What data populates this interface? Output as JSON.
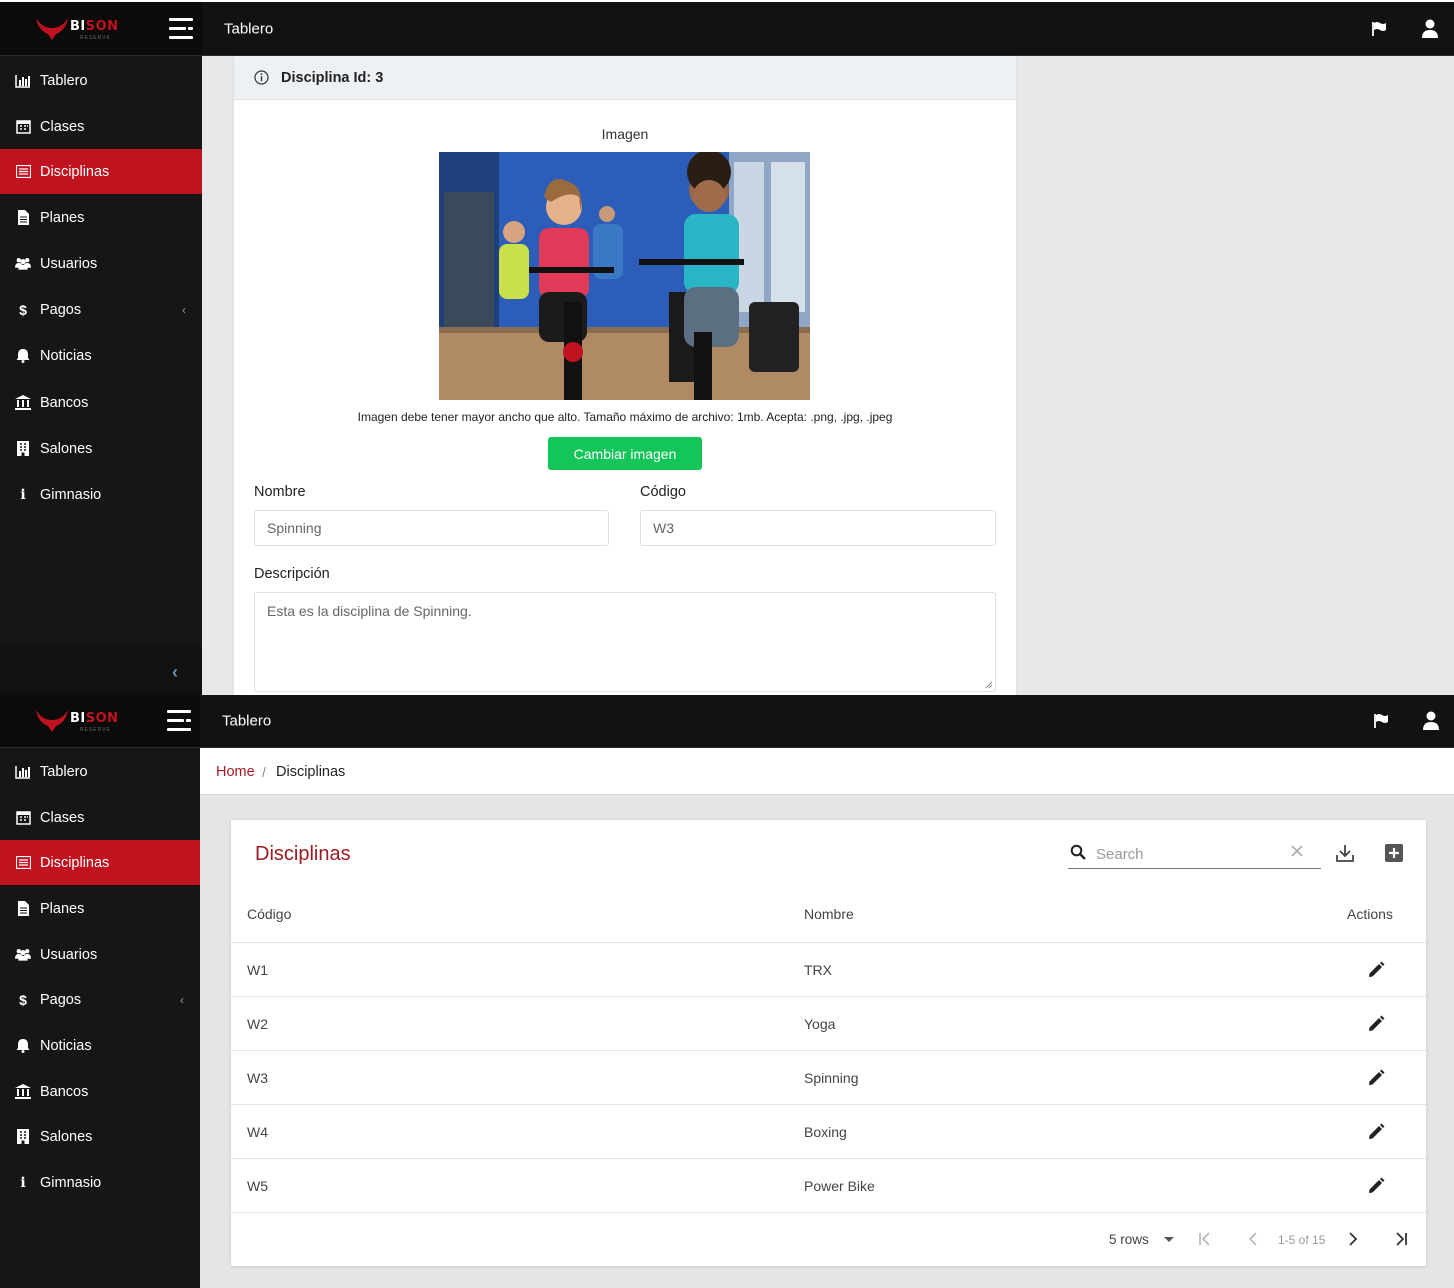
{
  "app": {
    "logo_text_white": "BI",
    "logo_text_red": "SON",
    "logo_subtext": "RESERVE",
    "header_title": "Tablero"
  },
  "sidebar": {
    "items": [
      {
        "label": "Tablero",
        "icon": "bar-chart-icon"
      },
      {
        "label": "Clases",
        "icon": "calendar-icon"
      },
      {
        "label": "Disciplinas",
        "icon": "list-icon",
        "active": true
      },
      {
        "label": "Planes",
        "icon": "document-icon"
      },
      {
        "label": "Usuarios",
        "icon": "users-icon"
      },
      {
        "label": "Pagos",
        "icon": "dollar-icon",
        "has_submenu": true,
        "caret": "‹"
      },
      {
        "label": "Noticias",
        "icon": "bell-icon"
      },
      {
        "label": "Bancos",
        "icon": "bank-icon"
      },
      {
        "label": "Salones",
        "icon": "building-icon"
      },
      {
        "label": "Gimnasio",
        "icon": "info-icon"
      }
    ]
  },
  "detail": {
    "title": "Disciplina Id: 3",
    "image_label": "Imagen",
    "image_hint": "Imagen debe tener mayor ancho que alto. Tamaño máximo de archivo: 1mb. Acepta: .png, .jpg, .jpeg",
    "change_image_button": "Cambiar imagen",
    "nombre_label": "Nombre",
    "nombre_value": "Spinning",
    "codigo_label": "Código",
    "codigo_value": "W3",
    "descripcion_label": "Descripción",
    "descripcion_value": "Esta es la disciplina de Spinning."
  },
  "list": {
    "breadcrumb_home": "Home",
    "breadcrumb_sep": "/",
    "breadcrumb_current": "Disciplinas",
    "title": "Disciplinas",
    "search_placeholder": "Search",
    "columns": {
      "codigo": "Código",
      "nombre": "Nombre",
      "actions": "Actions"
    },
    "rows": [
      {
        "codigo": "W1",
        "nombre": "TRX"
      },
      {
        "codigo": "W2",
        "nombre": "Yoga"
      },
      {
        "codigo": "W3",
        "nombre": "Spinning"
      },
      {
        "codigo": "W4",
        "nombre": "Boxing"
      },
      {
        "codigo": "W5",
        "nombre": "Power Bike"
      }
    ],
    "rows_per_page": "5 rows",
    "page_info": "1-5 of 15"
  },
  "colors": {
    "accent_red": "#c1121f",
    "green_button": "#14c55a",
    "title_red": "#9a1c22"
  }
}
